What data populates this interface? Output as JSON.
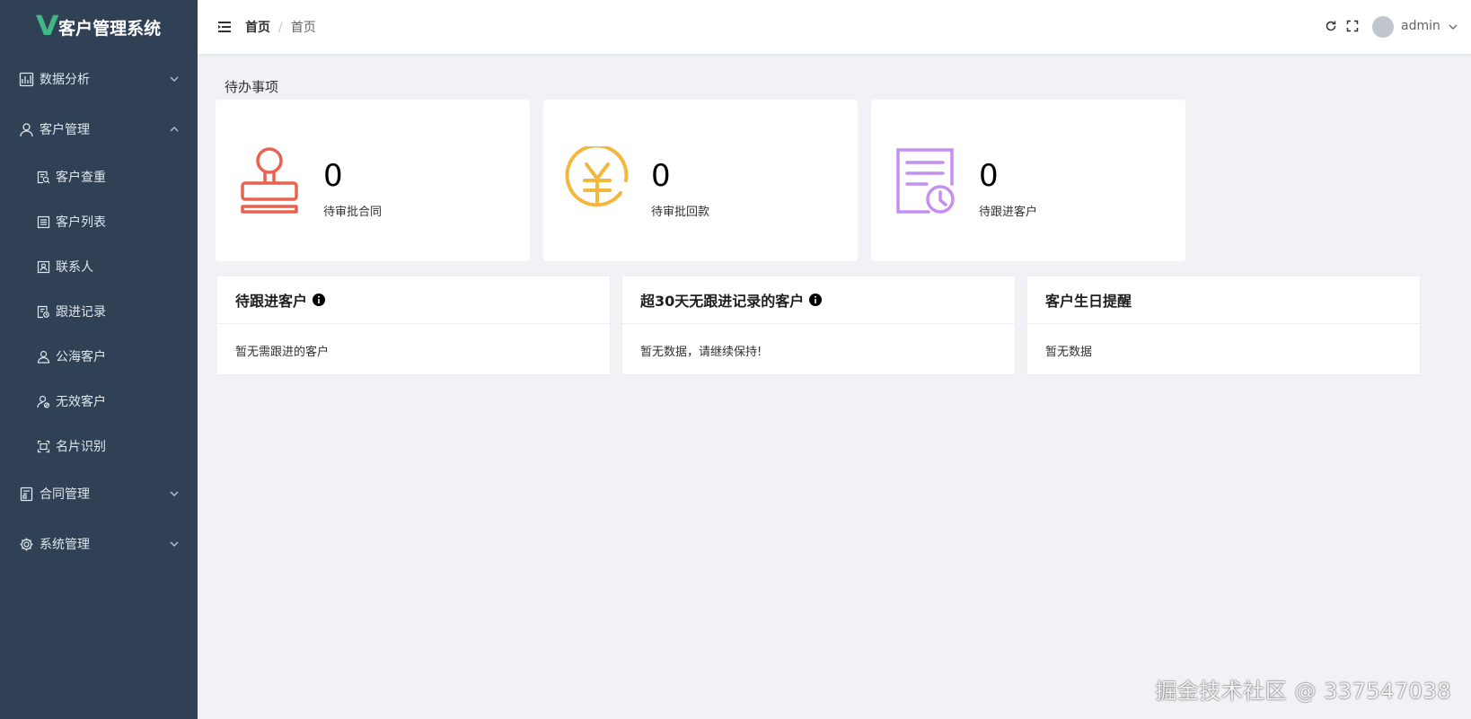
{
  "app": {
    "title": "客户管理系统",
    "logo_letter": "V"
  },
  "sidebar": {
    "groups": [
      {
        "label": "数据分析",
        "icon": "chart-icon",
        "expanded": false
      },
      {
        "label": "客户管理",
        "icon": "user-icon",
        "expanded": true,
        "items": [
          {
            "label": "客户查重",
            "icon": "search-doc-icon"
          },
          {
            "label": "客户列表",
            "icon": "list-icon"
          },
          {
            "label": "联系人",
            "icon": "contact-card-icon"
          },
          {
            "label": "跟进记录",
            "icon": "record-icon"
          },
          {
            "label": "公海客户",
            "icon": "user-outline-icon"
          },
          {
            "label": "无效客户",
            "icon": "user-invalid-icon"
          },
          {
            "label": "名片识别",
            "icon": "scan-icon"
          }
        ]
      },
      {
        "label": "合同管理",
        "icon": "contract-icon",
        "expanded": false
      },
      {
        "label": "系统管理",
        "icon": "gear-icon",
        "expanded": false
      }
    ]
  },
  "header": {
    "breadcrumb": [
      "首页",
      "首页"
    ],
    "separator": "/",
    "username": "admin"
  },
  "todo": {
    "title": "待办事项",
    "cards": [
      {
        "value": "0",
        "label": "待审批合同",
        "icon": "stamp-icon",
        "color": "#e8624f"
      },
      {
        "value": "0",
        "label": "待审批回款",
        "icon": "yen-icon",
        "color": "#f4b73d"
      },
      {
        "value": "0",
        "label": "待跟进客户",
        "icon": "followup-doc-icon",
        "color": "#c48ff0"
      }
    ]
  },
  "panels": [
    {
      "title": "待跟进客户",
      "has_info": true,
      "body": "暂无需跟进的客户"
    },
    {
      "title": "超30天无跟进记录的客户",
      "has_info": true,
      "body": "暂无数据，请继续保持!"
    },
    {
      "title": "客户生日提醒",
      "has_info": false,
      "body": "暂无数据"
    }
  ],
  "watermark": "掘金技术社区 @ 337547038",
  "colors": {
    "sidebar_bg": "#304156",
    "page_bg": "#f0f2f5",
    "logo_accent": "#41b883"
  }
}
